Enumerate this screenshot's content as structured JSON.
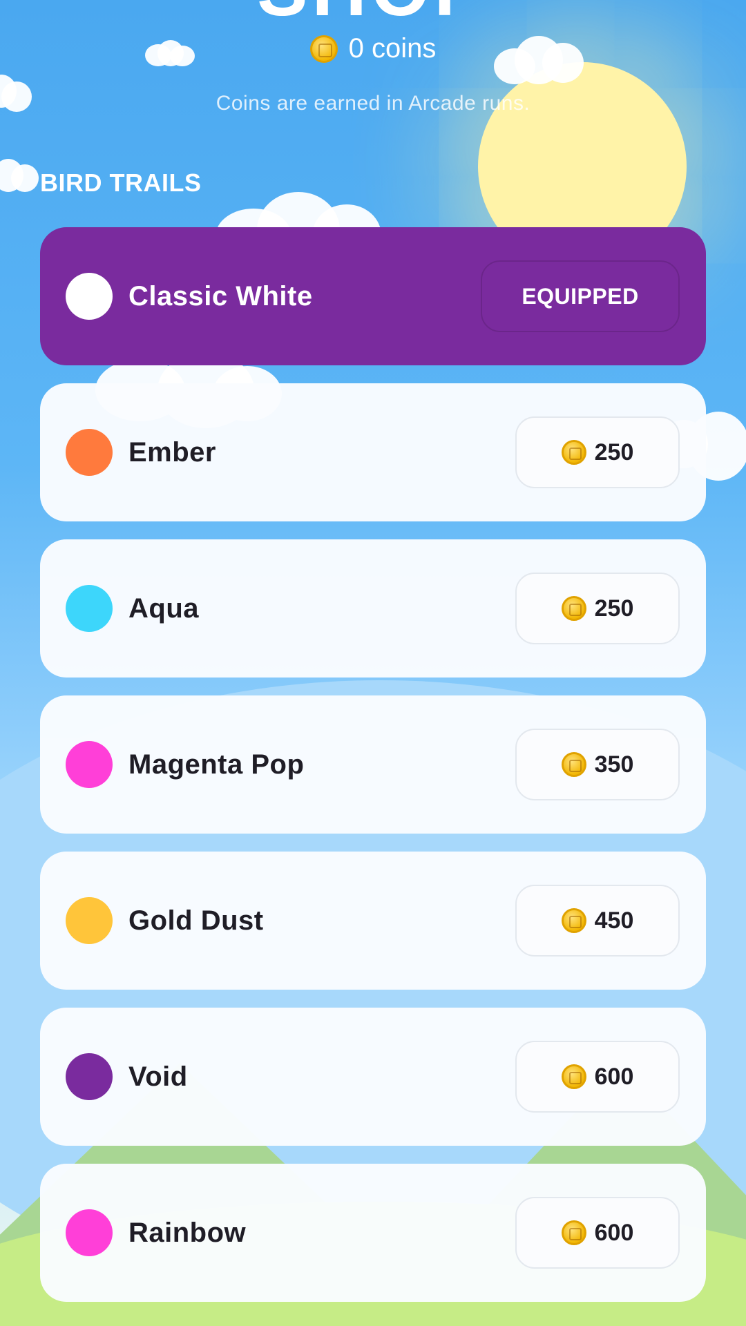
{
  "header": {
    "title": "SHOP",
    "coins_label": "0 coins",
    "hint": "Coins are earned in Arcade runs."
  },
  "section": {
    "label": "BIRD TRAILS"
  },
  "trails": [
    {
      "name": "Classic White",
      "color": "#ffffff",
      "status": "EQUIPPED"
    },
    {
      "name": "Ember",
      "color": "#ff7a3d",
      "price": "250"
    },
    {
      "name": "Aqua",
      "color": "#3dd6fb",
      "price": "250"
    },
    {
      "name": "Magenta Pop",
      "color": "#ff3fd8",
      "price": "350"
    },
    {
      "name": "Gold Dust",
      "color": "#ffc53a",
      "price": "450"
    },
    {
      "name": "Void",
      "color": "#7a2b9e",
      "price": "600"
    },
    {
      "name": "Rainbow",
      "color": "#ff3fd8",
      "price": "600"
    }
  ],
  "colors": {
    "equipped_card": "#7a2b9e",
    "sky_top": "#4aa8f0",
    "sun": "#fff3a8",
    "grass": "#c6ec86"
  },
  "icons": {
    "coin": "coin-icon"
  }
}
